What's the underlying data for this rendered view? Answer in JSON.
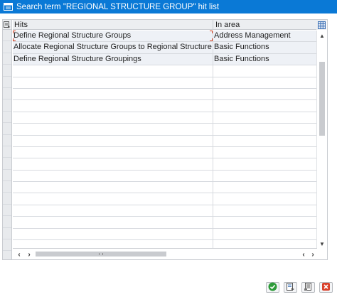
{
  "window": {
    "title": "Search term \"REGIONAL STRUCTURE GROUP\" hit list",
    "title_icon": "list-window-icon",
    "title_bar_color": "#0a79d6"
  },
  "table": {
    "columns": [
      "Hits",
      "In area"
    ],
    "rows": [
      {
        "hit": "Define Regional Structure Groups",
        "area": "Address Management"
      },
      {
        "hit": "Allocate Regional Structure Groups to Regional Structure Areas",
        "area": "Basic Functions"
      },
      {
        "hit": "Define Regional Structure Groupings",
        "area": "Basic Functions"
      }
    ],
    "empty_row_count": 16,
    "focused_row": 0
  },
  "buttons": {
    "confirm_icon": "green-check-icon",
    "select_icon": "select-list-icon",
    "print_icon": "print-list-icon",
    "cancel_icon": "cancel-x-icon"
  },
  "colors": {
    "accent": "#0a79d6",
    "row_fill": "#eef1f6",
    "focus_marker": "#d23b1a"
  }
}
